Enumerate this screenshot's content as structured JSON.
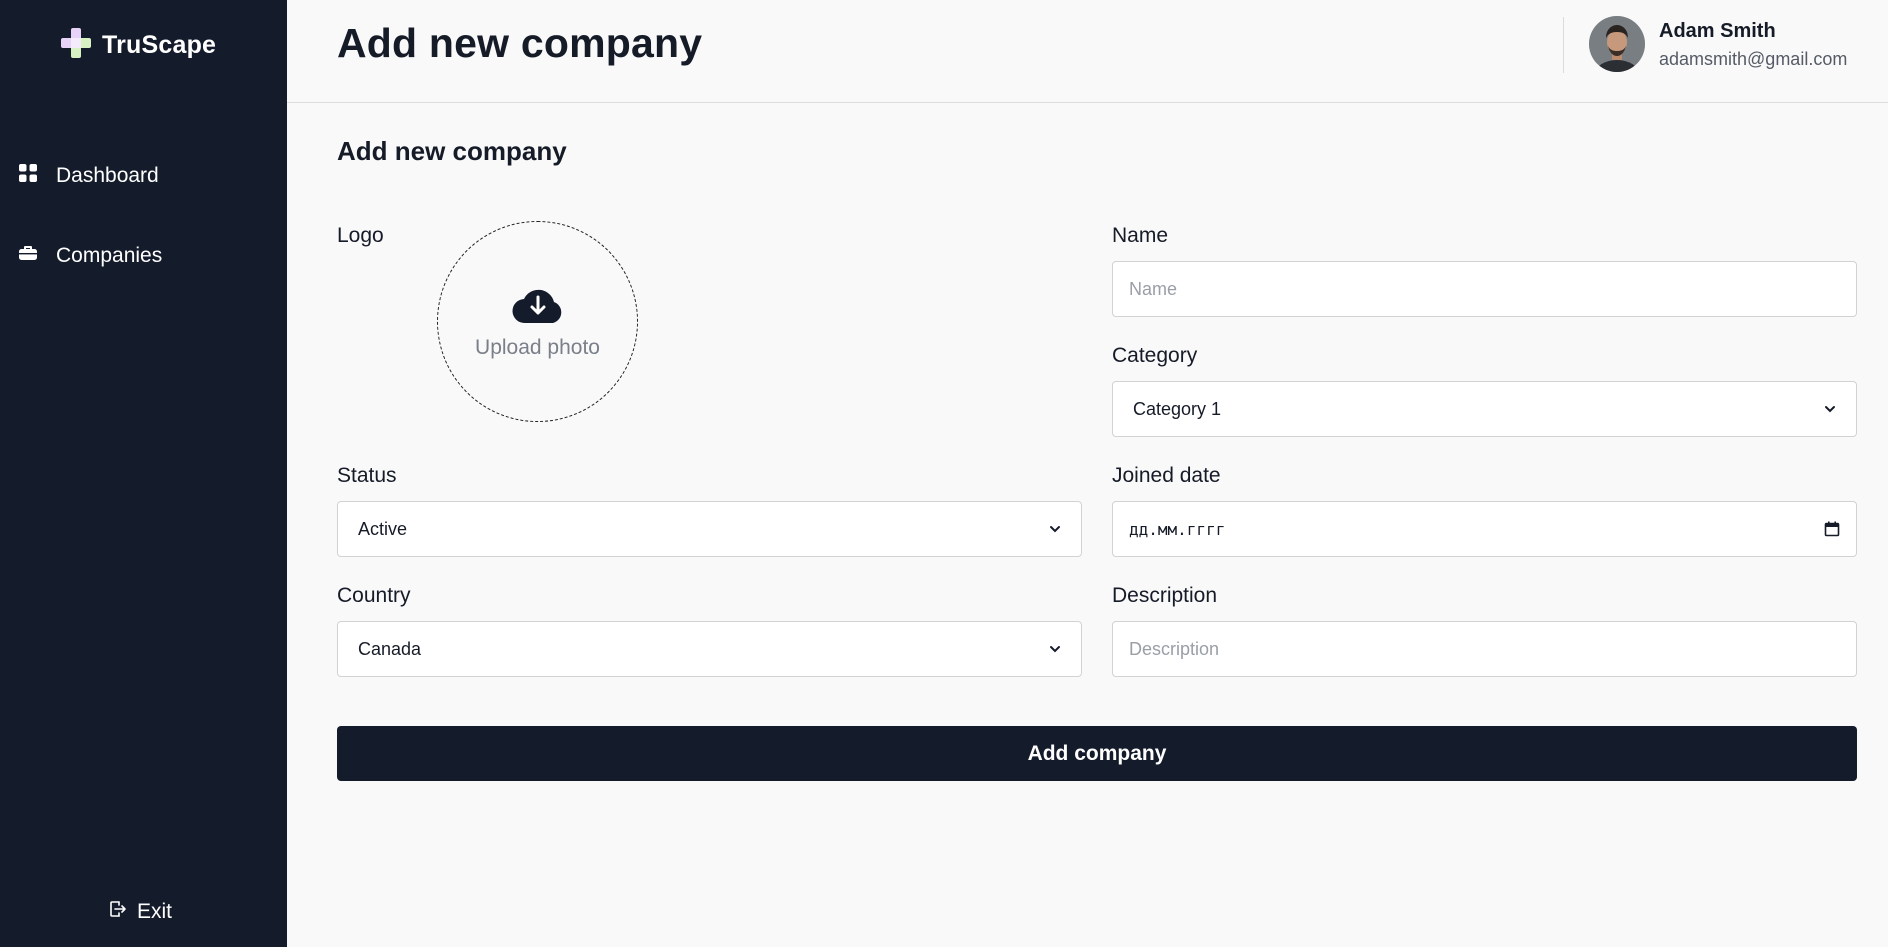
{
  "sidebar": {
    "brand": "TruScape",
    "items": [
      {
        "label": "Dashboard",
        "icon": "grid-icon"
      },
      {
        "label": "Companies",
        "icon": "briefcase-icon"
      }
    ],
    "exit_label": "Exit"
  },
  "header": {
    "title": "Add new company",
    "user": {
      "name": "Adam Smith",
      "email": "adamsmith@gmail.com"
    }
  },
  "form": {
    "section_title": "Add new company",
    "logo_label": "Logo",
    "upload_text": "Upload photo",
    "name_label": "Name",
    "name_placeholder": "Name",
    "category_label": "Category",
    "category_value": "Category 1",
    "status_label": "Status",
    "status_value": "Active",
    "joined_label": "Joined date",
    "joined_value": "дд.мм.гггг",
    "country_label": "Country",
    "country_value": "Canada",
    "description_label": "Description",
    "description_placeholder": "Description",
    "submit_label": "Add company"
  },
  "colors": {
    "sidebar_bg": "#141b2b",
    "brand_accent_1": "#e6d3f7",
    "brand_accent_2": "#d9f2c4",
    "page_bg": "#f9f9f9",
    "button_bg": "#141b2b"
  }
}
